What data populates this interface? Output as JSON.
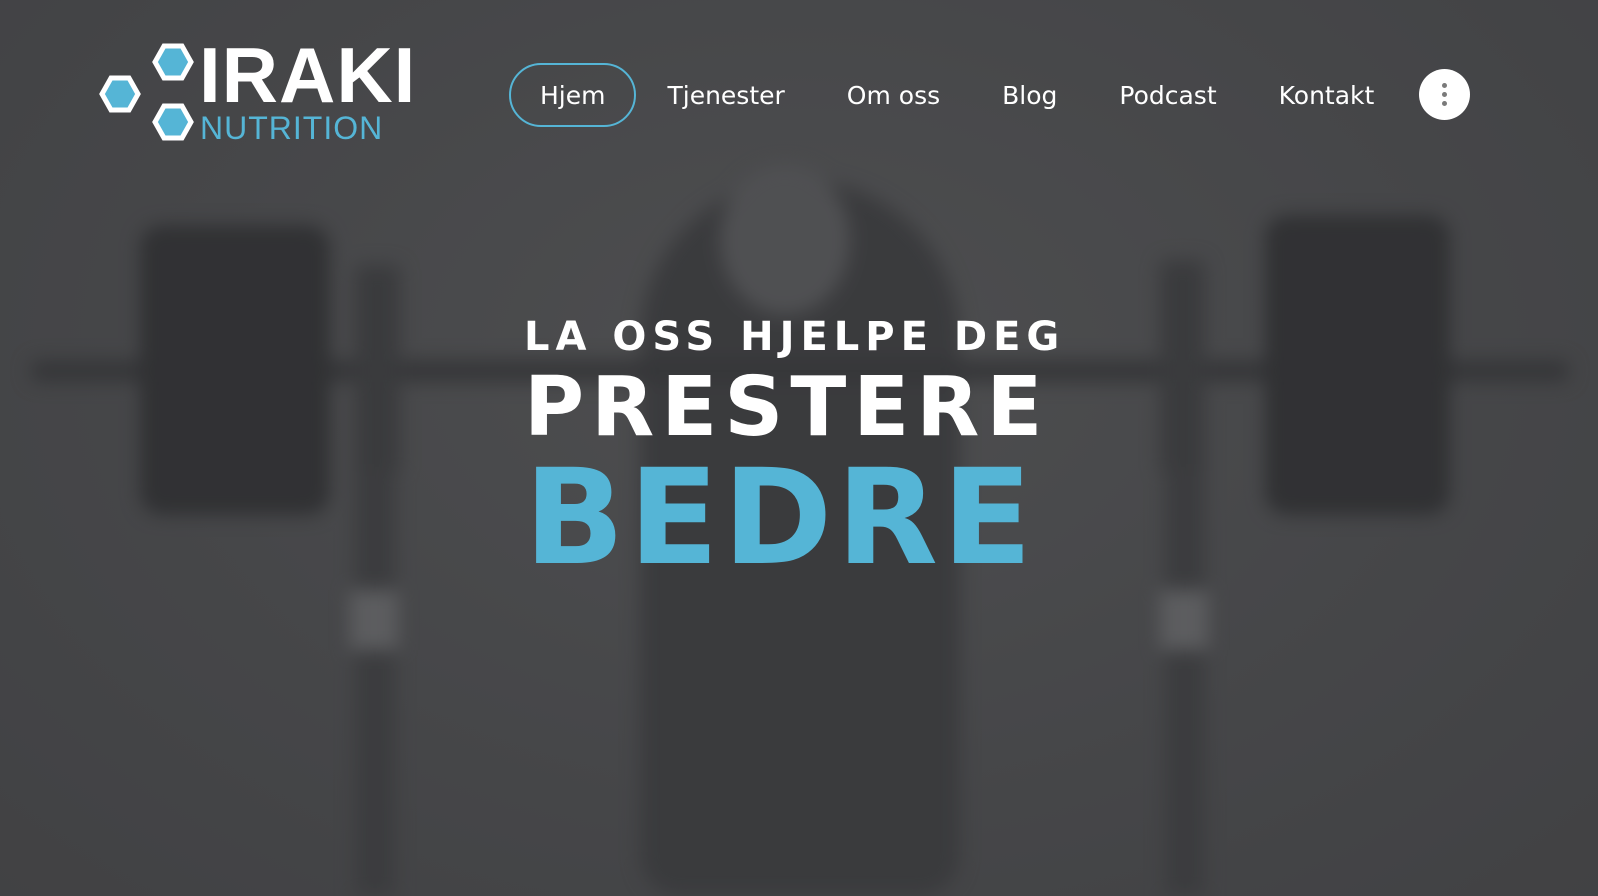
{
  "brand": {
    "name": "IRAKI",
    "subtitle": "NUTRITION",
    "accent_color": "#55b5d6"
  },
  "nav": {
    "items": [
      {
        "label": "Hjem",
        "active": true
      },
      {
        "label": "Tjenester",
        "active": false
      },
      {
        "label": "Om oss",
        "active": false
      },
      {
        "label": "Blog",
        "active": false
      },
      {
        "label": "Podcast",
        "active": false
      },
      {
        "label": "Kontakt",
        "active": false
      }
    ],
    "menu_icon": "vertical-dots-icon"
  },
  "hero": {
    "line1": "LA OSS HJELPE DEG",
    "line2": "PRESTERE",
    "line3": "BEDRE",
    "background": "blurred-weightlifter-photo"
  }
}
